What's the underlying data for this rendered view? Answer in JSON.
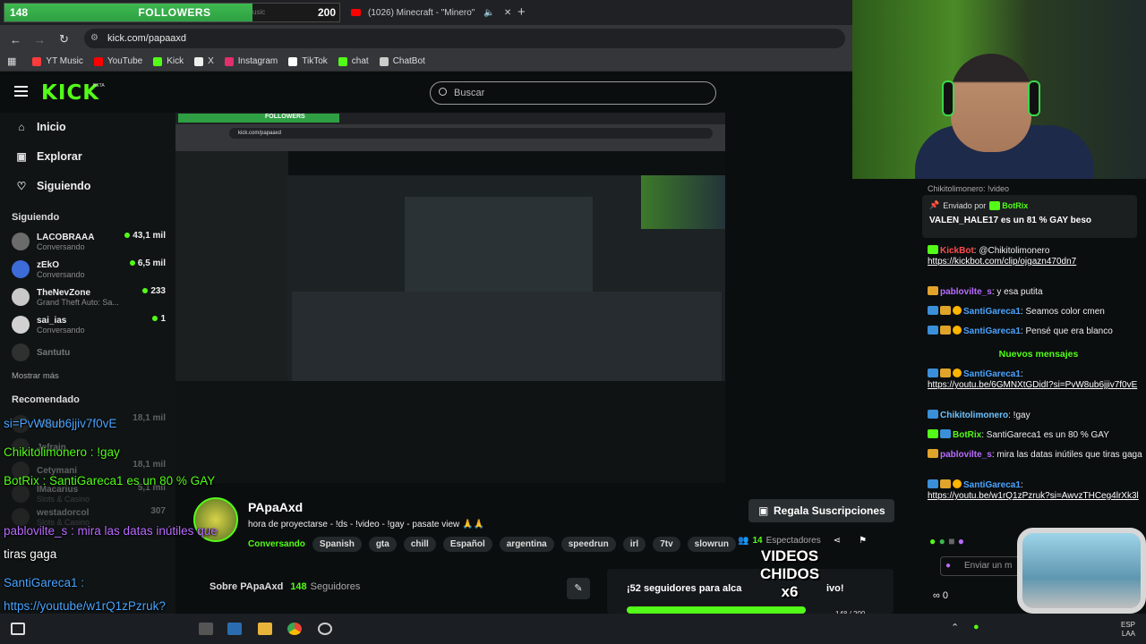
{
  "browser": {
    "followers": {
      "current": "148",
      "label": "FOLLOWERS",
      "goal": "200",
      "ghost_text": "usic",
      "progress": 0.74
    },
    "tab": {
      "title": "(1026) Minecraft - \"Minero\"",
      "mute": "🔈",
      "close": "✕"
    },
    "new_tab": "+",
    "nav": {
      "back": "←",
      "forward": "→",
      "reload": "↻"
    },
    "url": "kick.com/papaaxd",
    "bookmarks": [
      {
        "label": "YT Music",
        "color": "#ff3b3b"
      },
      {
        "label": "YouTube",
        "color": "#ff0000"
      },
      {
        "label": "Kick",
        "color": "#53fc18"
      },
      {
        "label": "X",
        "color": "#eeeeee"
      },
      {
        "label": "Instagram",
        "color": "#e1306c"
      },
      {
        "label": "TikTok",
        "color": "#ffffff"
      },
      {
        "label": "chat",
        "color": "#53fc18"
      },
      {
        "label": "ChatBot",
        "color": "#cccccc"
      }
    ]
  },
  "kick": {
    "logo": "KICK",
    "beta": "BETA",
    "search_placeholder": "Buscar",
    "nav": [
      {
        "label": "Inicio",
        "icon": "⌂"
      },
      {
        "label": "Explorar",
        "icon": "▣"
      },
      {
        "label": "Siguiendo",
        "icon": "♡"
      }
    ],
    "following_heading": "Siguiendo",
    "channels": [
      {
        "name": "LACOBRAAA",
        "sub": "Conversando",
        "count": "43,1 mil",
        "live": true
      },
      {
        "name": "zEkO",
        "sub": "Conversando",
        "count": "6,5 mil",
        "live": true
      },
      {
        "name": "TheNevZone",
        "sub": "Grand Theft Auto: Sa...",
        "count": "233",
        "live": true
      },
      {
        "name": "sai_ias",
        "sub": "Conversando",
        "count": "1",
        "live": true
      },
      {
        "name": "Santutu",
        "sub": "",
        "count": "",
        "live": false
      }
    ],
    "show_more": "Mostrar más",
    "recommended_heading": "Recomendado",
    "recommended": [
      {
        "name": "RDjavi",
        "count": "18,1 mil"
      },
      {
        "name": "Jefrain",
        "count": ""
      },
      {
        "name": "Cetymani",
        "count": "18,1 mil"
      },
      {
        "name": "IMacarius",
        "sub": "Slots & Casino",
        "count": "5,1 mil"
      },
      {
        "name": "westadorcol",
        "sub": "Slots & Casino",
        "count": "307"
      }
    ]
  },
  "stream": {
    "streamer": "PApaAxd",
    "title": "hora de proyectarse - !ds - !video - !gay - pasate view 🙏🙏",
    "category": "Conversando",
    "tags": [
      "Spanish",
      "gta",
      "chill",
      "Español",
      "argentina",
      "speedrun",
      "irl",
      "7tv",
      "slowrun"
    ],
    "subscribe": "Regala Suscripciones",
    "viewers": "14",
    "viewers_label": "Espectadores",
    "about_prefix": "Sobre PApaAxd",
    "followers_count": "148",
    "followers_label": "Seguidores",
    "goal_text": "¡52 seguidores para alca",
    "goal_tail": "ivo!",
    "goal_count": "148 / 200",
    "videos_overlay": "VIDEOS CHIDOS x6"
  },
  "chat": {
    "pinned_by": "Enviado por",
    "pinned_user": "BotRix",
    "pinned_msg": "VALEN_HALE17 es un 81 % GAY beso",
    "prev_line": "Chikitolimonero: !video",
    "messages": [
      {
        "user": "KickBot",
        "cls": "u-red",
        "text": ": @Chikitolimonero",
        "link": "https://kickbot.com/clip/ojgazn470dn7",
        "badges": [
          "b-kick"
        ]
      },
      {
        "user": "pablovilte_s",
        "cls": "u-purple",
        "text": ": y esa putita",
        "link": "",
        "badges": [
          "b-crown"
        ]
      },
      {
        "user": "SantiGareca1",
        "cls": "u-blue",
        "text": ": Seamos color cmen",
        "link": "",
        "badges": [
          "b-blue",
          "b-crown",
          "b-gold"
        ]
      },
      {
        "user": "SantiGareca1",
        "cls": "u-blue",
        "text": ": Pensé que era blanco",
        "link": "",
        "badges": [
          "b-blue",
          "b-crown",
          "b-gold"
        ]
      }
    ],
    "new_messages": "Nuevos mensajes",
    "messages_after": [
      {
        "user": "SantiGareca1",
        "cls": "u-blue",
        "text": ":",
        "link": "https://youtu.be/6GMNXtGDidI?si=PvW8ub6jjiv7f0vE",
        "badges": [
          "b-blue",
          "b-crown",
          "b-gold"
        ]
      },
      {
        "user": "Chikitolimonero",
        "cls": "u-ltblue",
        "text": ": !gay",
        "link": "",
        "badges": [
          "b-blue"
        ]
      },
      {
        "user": "BotRix",
        "cls": "u-green",
        "text": ": SantiGareca1 es un 80 % GAY",
        "link": "",
        "badges": [
          "b-kick",
          "b-blue"
        ]
      },
      {
        "user": "pablovilte_s",
        "cls": "u-purple",
        "text": ": mira las datas inútiles que tiras gaga",
        "link": "",
        "badges": [
          "b-crown"
        ]
      },
      {
        "user": "SantiGareca1",
        "cls": "u-blue",
        "text": ":",
        "link": "https://youtu.be/w1rQ1zPzruk?si=AwvzTHCeg4lrXk3l",
        "badges": [
          "b-blue",
          "b-crown",
          "b-gold"
        ]
      }
    ],
    "send_placeholder": "Enviar un m",
    "footer": "∞   0"
  },
  "overlay_chat": [
    {
      "text": "si=PvW8ub6jjiv7f0vE",
      "cls": "ov-blue"
    },
    {
      "text": "Chikitolimonero : !gay",
      "cls": "ov-green"
    },
    {
      "text": "BotRix : SantiGareca1 es un 80 % GAY",
      "cls": "ov-green"
    },
    {
      "text": "pablovilte_s : mira las datas inútiles que",
      "cls": "ov-purple"
    },
    {
      "text": "tiras gaga",
      "cls": ""
    },
    {
      "text": "SantiGareca1 :",
      "cls": "ov-blue"
    },
    {
      "text": "https://youtube/w1rQ1zPzruk?",
      "cls": "ov-blue"
    },
    {
      "text": "si=AwvzTHCeg4lrXk3l",
      "cls": "ov-blue"
    }
  ],
  "taskbar": {
    "lang": "ESP",
    "region": "LAA"
  }
}
